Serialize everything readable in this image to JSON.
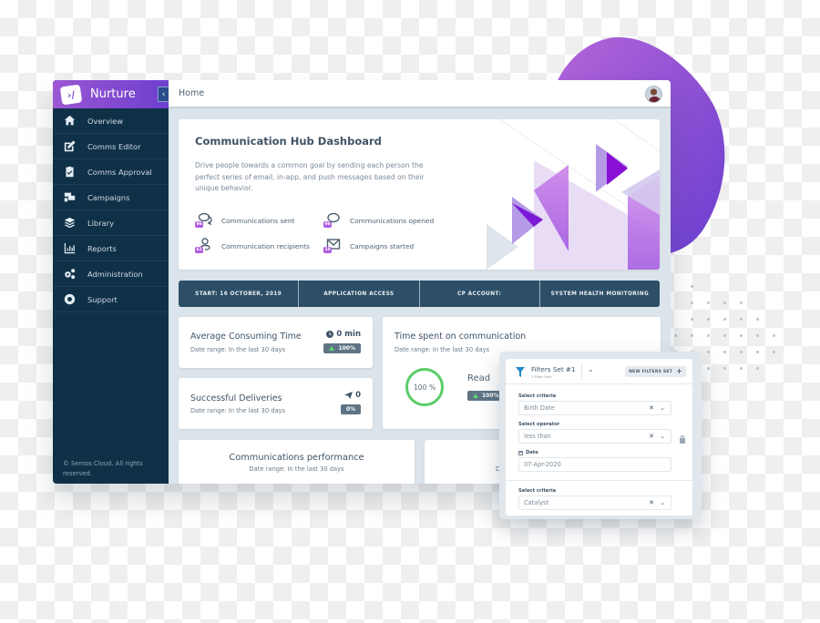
{
  "colors": {
    "brand_gradient_start": "#9b57d3",
    "brand_gradient_end": "#6d3fce",
    "sidebar_bg": "#0f3148",
    "infobar_bg": "#2c4e66",
    "accent_green": "#5ccd68",
    "badge_purple": "#b05be0",
    "filter_icon": "#1f8ac9"
  },
  "sidebar": {
    "brand_logo": "›/",
    "brand_name": "Nurture",
    "collapse_icon": "‹",
    "items": [
      {
        "label": "Overview",
        "icon": "home-icon"
      },
      {
        "label": "Comms Editor",
        "icon": "edit-icon"
      },
      {
        "label": "Comms Approval",
        "icon": "clipboard-check-icon"
      },
      {
        "label": "Campaigns",
        "icon": "campaigns-icon"
      },
      {
        "label": "Library",
        "icon": "layers-icon"
      },
      {
        "label": "Reports",
        "icon": "bar-chart-icon"
      },
      {
        "label": "Administration",
        "icon": "gears-icon"
      },
      {
        "label": "Support",
        "icon": "lifebuoy-icon"
      }
    ],
    "copyright": "© Semos Cloud. All rights reserved."
  },
  "topbar": {
    "title": "Home"
  },
  "hero": {
    "title": "Communication Hub Dashboard",
    "description": "Drive people towards a common goal by sending each person the perfect series of email, in-app, and push messages based on their unique behavior.",
    "stats": [
      {
        "label": "Communications sent",
        "badge": "96",
        "icon": "chat-bubbles-icon"
      },
      {
        "label": "Communications opened",
        "badge": "96",
        "icon": "chat-bubble-icon"
      },
      {
        "label": "Communication recipients",
        "badge": "62",
        "icon": "user-icon"
      },
      {
        "label": "Campaigns started",
        "badge": "10",
        "icon": "envelope-icon"
      }
    ]
  },
  "infobar": {
    "cells": [
      "START: 16 OCTOBER, 2019",
      "APPLICATION ACCESS",
      "CP ACCOUNT:",
      "SYSTEM HEALTH MONITORING"
    ]
  },
  "metrics": {
    "avg_time": {
      "title": "Average Consuming Time",
      "subtitle": "Date range: In the last 30 days",
      "value": "0 min",
      "change": "100%"
    },
    "deliveries": {
      "title": "Successful Deliveries",
      "subtitle": "Date range: In the last 30 days",
      "value": "0",
      "change": "0%"
    },
    "time_spent": {
      "title": "Time spent on communication",
      "subtitle": "Date range: In the last 30 days",
      "ring_value": "100 %",
      "ring_fraction": 1.0,
      "read_label": "Read",
      "read_change": "100%"
    },
    "performance": {
      "title": "Communications performance",
      "subtitle": "Date range: In the last 30 days"
    },
    "partial_card_sub": "D"
  },
  "filters": {
    "title": "Filters Set #1",
    "subtitle": "1 Filter Sets",
    "new_button": "NEW FILTERS SET",
    "rows": [
      {
        "label": "Select criteria",
        "value": "Birth Date"
      },
      {
        "label": "Select operator",
        "value": "less than"
      },
      {
        "label": "Date",
        "value": "07-Apr-2020"
      },
      {
        "label": "Select criteria",
        "value": "Catalyst"
      }
    ]
  }
}
